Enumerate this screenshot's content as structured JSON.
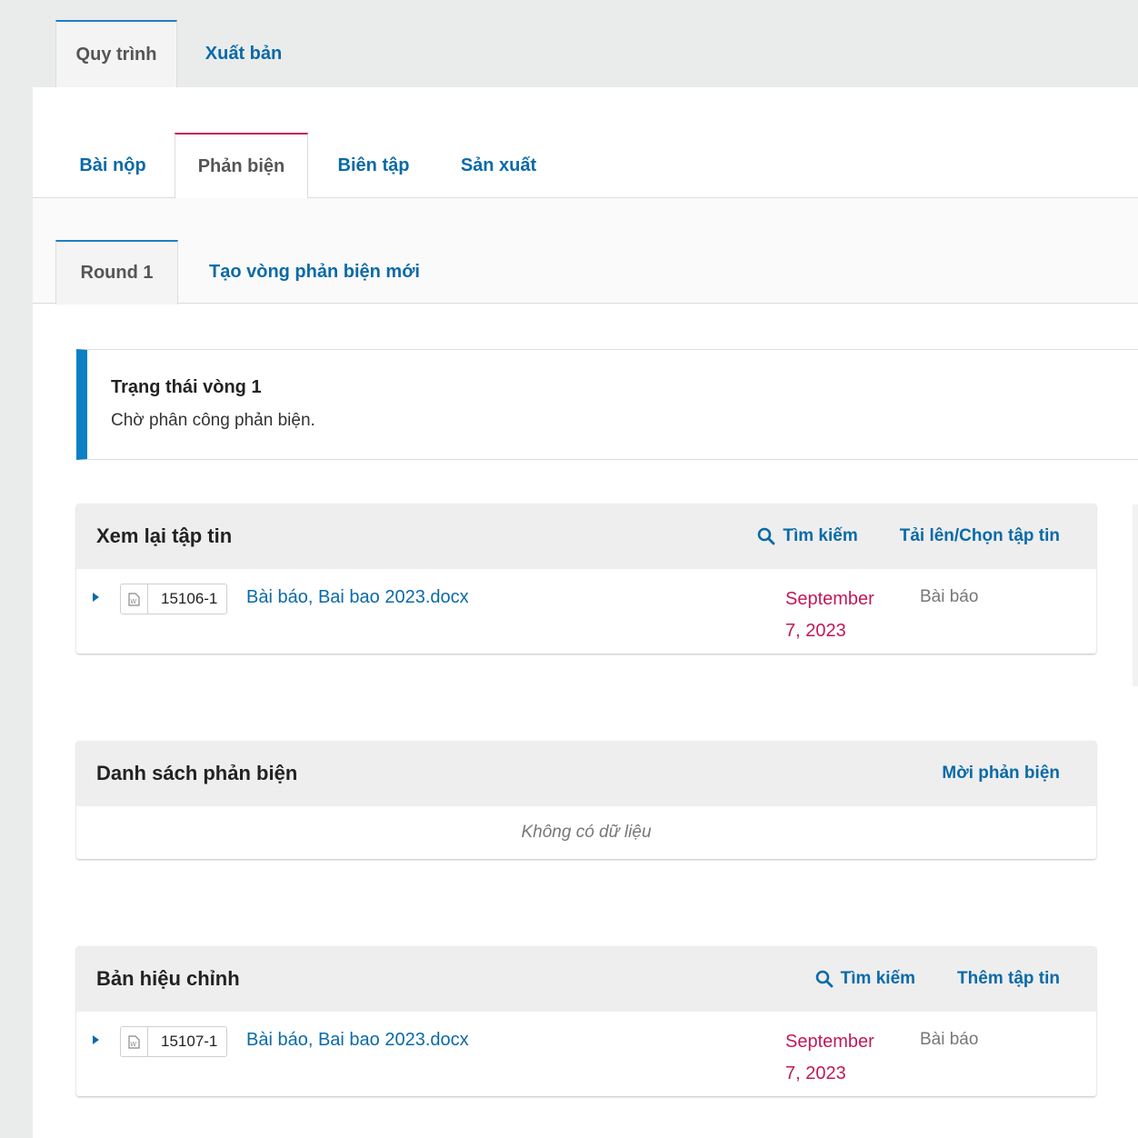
{
  "top_tabs": {
    "workflow": "Quy trình",
    "publication": "Xuất bản"
  },
  "stage_tabs": [
    {
      "label": "Bài nộp"
    },
    {
      "label": "Phản biện"
    },
    {
      "label": "Biên tập"
    },
    {
      "label": "Sản xuất"
    }
  ],
  "round_tabs": {
    "round1": "Round 1",
    "new_round": "Tạo vòng phản biện mới"
  },
  "status": {
    "title": "Trạng thái vòng 1",
    "text": "Chờ phân công phản biện."
  },
  "review_files": {
    "title": "Xem lại tập tin",
    "search": "Tìm kiếm",
    "upload": "Tải lên/Chọn tập tin",
    "rows": [
      {
        "id": "15106-1",
        "name": "Bài báo, Bai bao 2023.docx",
        "date_line1": "September",
        "date_line2": "7, 2023",
        "type": "Bài báo"
      }
    ]
  },
  "reviewers": {
    "title": "Danh sách phản biện",
    "invite": "Mời phản biện",
    "empty": "Không có dữ liệu"
  },
  "revisions": {
    "title": "Bản hiệu chỉnh",
    "search": "Tìm kiếm",
    "add": "Thêm tập tin",
    "rows": [
      {
        "id": "15107-1",
        "name": "Bài báo, Bai bao 2023.docx",
        "date_line1": "September",
        "date_line2": "7, 2023",
        "type": "Bài báo"
      }
    ]
  },
  "colors": {
    "link": "#0a6aa8",
    "date": "#c21859",
    "status_bar": "#0c80c4",
    "active_stage_border": "#c21859"
  }
}
